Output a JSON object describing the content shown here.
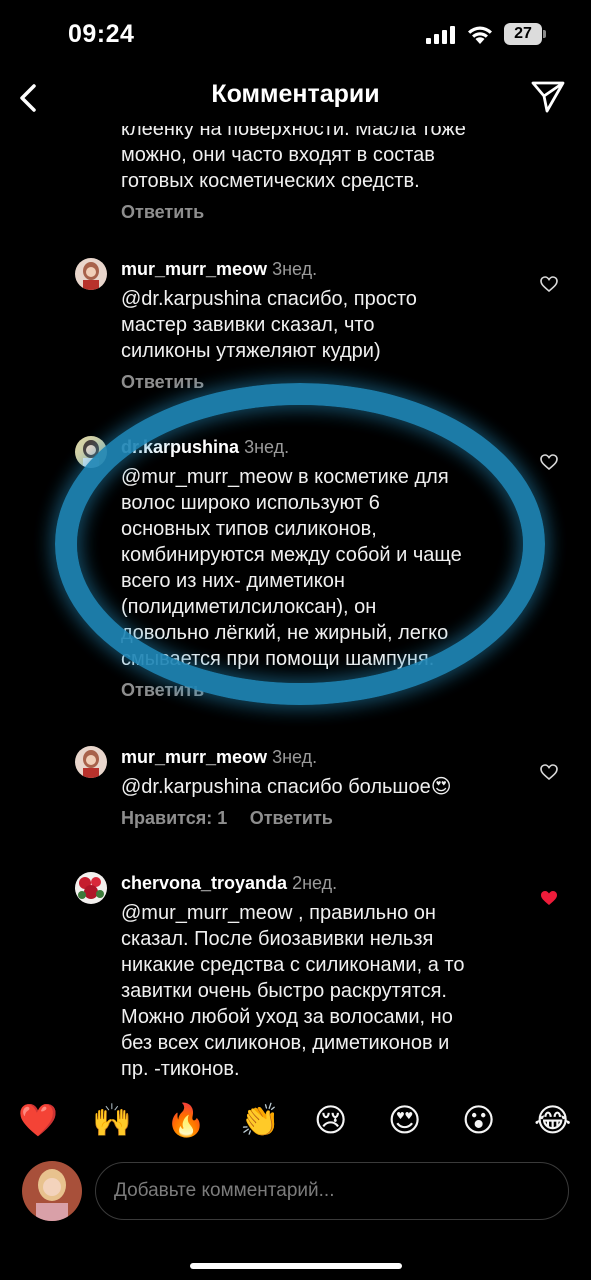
{
  "status_bar": {
    "time": "09:24",
    "battery": "27"
  },
  "header": {
    "title": "Комментарии"
  },
  "first_block": {
    "text": "клеёнку на поверхности. Масла тоже\nможно, они часто входят в состав\nготовых косметических средств.",
    "reply_label": "Ответить"
  },
  "comments": [
    {
      "username": "mur_murr_meow",
      "time": "3нед.",
      "text": "@dr.karpushina спасибо, просто\nмастер завивки сказал, что\nсиликоны утяжеляют кудри)",
      "reply_label": "Ответить",
      "liked": false
    },
    {
      "username": "dr.karpushina",
      "time": "3нед.",
      "text": "@mur_murr_meow в косметике для\nволос широко используют 6\nосновных типов силиконов,\nкомбинируются между собой и чаще\nвсего из них-  диметикон\n(полидиметилсилоксан), он\nдовольно лёгкий, не жирный, легко\nсмывается при помощи шампуня.",
      "reply_label": "Ответить",
      "liked": false
    },
    {
      "username": "mur_murr_meow",
      "time": "3нед.",
      "text": "@dr.karpushina спасибо большое😍",
      "likes_label": "Нравится: 1",
      "reply_label": "Ответить",
      "liked": false
    },
    {
      "username": "chervona_troyanda",
      "time": "2нед.",
      "text": "@mur_murr_meow , правильно он\nсказал. После биозавивки нельзя\nникакие средства с силиконами, а то\nзавитки очень быстро раскрутятся.\nМожно любой уход за волосами, но\nбез всех силиконов, диметиконов и\nпр. -тиконов.",
      "liked": true
    }
  ],
  "emoji_bar": [
    "❤️",
    "🙌",
    "🔥",
    "👏",
    "😢",
    "😍",
    "😮",
    "😂"
  ],
  "comment_input": {
    "placeholder": "Добавьте комментарий..."
  },
  "colors": {
    "background": "#000000",
    "secondary_text": "#8e8e8e",
    "like_red": "#ed4956",
    "highlight_ring": "#1f86b6"
  }
}
